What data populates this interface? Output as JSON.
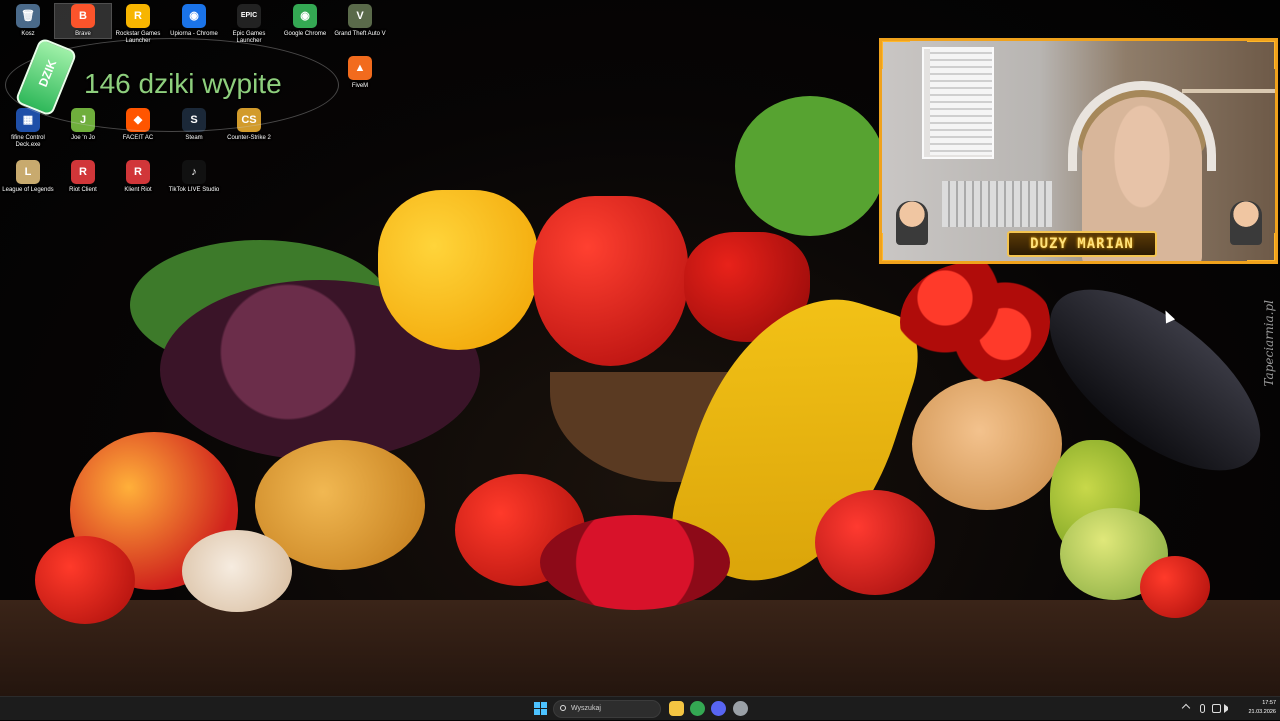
{
  "desktop": {
    "icons": [
      {
        "label": "Kosz",
        "glyph": "🗑",
        "color": "#4a6a8a"
      },
      {
        "label": "Brave",
        "glyph": "B",
        "color": "#fb542b"
      },
      {
        "label": "Rockstar Games Launcher",
        "glyph": "R",
        "color": "#f7b500"
      },
      {
        "label": "Upiorna - Chrome",
        "glyph": "◉",
        "color": "#1a73e8"
      },
      {
        "label": "Epic Games Launcher",
        "glyph": "EPIC",
        "color": "#222222"
      },
      {
        "label": "Google Chrome",
        "glyph": "◉",
        "color": "#34a853"
      },
      {
        "label": "Grand Theft Auto V",
        "glyph": "V",
        "color": "#5a6a4a"
      },
      {
        "label": "FiveM",
        "glyph": "▲",
        "color": "#f26b1d"
      },
      {
        "label": "fifine Control Deck.exe",
        "glyph": "▦",
        "color": "#1f4fa8"
      },
      {
        "label": "Joe 'n Jo",
        "glyph": "J",
        "color": "#6fae3c"
      },
      {
        "label": "FACEIT AC",
        "glyph": "◆",
        "color": "#ff5500"
      },
      {
        "label": "Steam",
        "glyph": "S",
        "color": "#1b2838"
      },
      {
        "label": "Counter-Strike 2",
        "glyph": "CS",
        "color": "#d29b2b"
      },
      {
        "label": "League of Legends",
        "glyph": "L",
        "color": "#c8aa6e"
      },
      {
        "label": "Riot Client",
        "glyph": "R",
        "color": "#d13639"
      },
      {
        "label": "Klient Riot",
        "glyph": "R",
        "color": "#d13639"
      },
      {
        "label": "TikTok LIVE Studio",
        "glyph": "♪",
        "color": "#111111"
      }
    ],
    "watermark": "Tapeciarnia.pl"
  },
  "overlay": {
    "counter_text": "146 dziki wypite",
    "can_text": "DZIK"
  },
  "webcam": {
    "name_banner": "DUZY MARIAN"
  },
  "taskbar": {
    "search_placeholder": "Wyszukaj",
    "apps": [
      {
        "name": "file-explorer",
        "color": "#f4c542"
      },
      {
        "name": "chrome",
        "color": "#34a853"
      },
      {
        "name": "discord",
        "color": "#5865f2"
      },
      {
        "name": "settings",
        "color": "#9aa0a6"
      }
    ],
    "clock": {
      "time": "17:57",
      "date": "21.03.2026"
    }
  }
}
